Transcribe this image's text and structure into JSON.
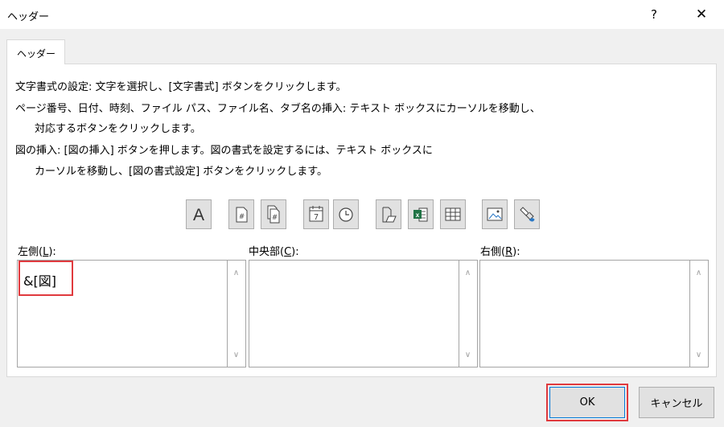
{
  "window": {
    "title": "ヘッダー",
    "help_label": "?",
    "close_label": "✕"
  },
  "tab": {
    "label": "ヘッダー"
  },
  "instructions": [
    "文字書式の設定: 文字を選択し、[文字書式] ボタンをクリックします。",
    "ページ番号、日付、時刻、ファイル パス、ファイル名、タブ名の挿入: テキスト ボックスにカーソルを移動し、",
    "対応するボタンをクリックします。",
    "図の挿入: [図の挿入] ボタンを押します。図の書式を設定するには、テキスト ボックスに",
    "カーソルを移動し、[図の書式設定] ボタンをクリックします。"
  ],
  "toolbar": {
    "format_text": {
      "icon": "format-text-icon",
      "glyph": "A"
    },
    "page_number": {
      "icon": "page-number-icon",
      "glyph": "#"
    },
    "number_of_pages": {
      "icon": "number-of-pages-icon",
      "glyph": "#"
    },
    "date": {
      "icon": "date-icon",
      "glyph": "7"
    },
    "time": {
      "icon": "time-icon"
    },
    "file_path": {
      "icon": "file-path-icon"
    },
    "file_name": {
      "icon": "file-name-icon"
    },
    "sheet_name": {
      "icon": "sheet-name-icon"
    },
    "insert_picture": {
      "icon": "insert-picture-icon"
    },
    "format_picture": {
      "icon": "format-picture-icon"
    }
  },
  "sections": {
    "left": {
      "label_prefix": "左側(",
      "label_key": "L",
      "label_suffix": "):",
      "value": "&[図]"
    },
    "center": {
      "label_prefix": "中央部(",
      "label_key": "C",
      "label_suffix": "):",
      "value": ""
    },
    "right": {
      "label_prefix": "右側(",
      "label_key": "R",
      "label_suffix": "):",
      "value": ""
    }
  },
  "scroll": {
    "up": "∧",
    "down": "∨"
  },
  "buttons": {
    "ok": "OK",
    "cancel": "キャンセル"
  },
  "colors": {
    "highlight": "#e03a3e",
    "excel_green": "#217346",
    "ok_border": "#0078d7"
  }
}
